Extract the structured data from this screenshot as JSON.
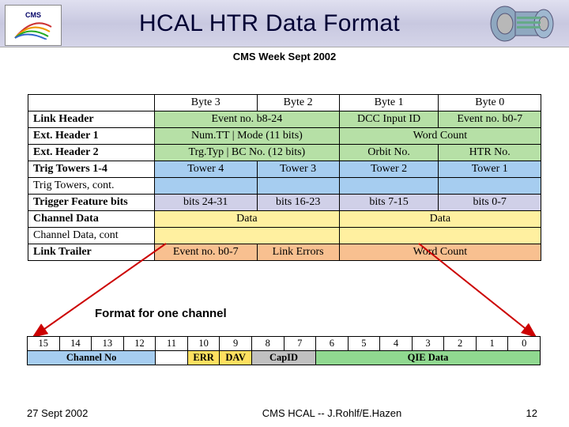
{
  "header": {
    "logo_text": "CMS",
    "title": "HCAL HTR Data Format",
    "subtitle": "CMS Week Sept 2002"
  },
  "main_table": {
    "head": [
      "",
      "Byte 3",
      "Byte 2",
      "Byte 1",
      "Byte 0"
    ],
    "rows": [
      {
        "cls": "r-link",
        "bold": true,
        "label": "Link Header",
        "c": [
          {
            "t": "Event no. b8-24",
            "span": 2
          },
          {
            "t": "DCC Input ID",
            "span": 1
          },
          {
            "t": "Event no. b0-7",
            "span": 1
          }
        ]
      },
      {
        "cls": "r-ext",
        "bold": true,
        "label": "Ext. Header 1",
        "c": [
          {
            "t": "Num.TT   |   Mode (11 bits)",
            "span": 2
          },
          {
            "t": "Word Count",
            "span": 2
          }
        ]
      },
      {
        "cls": "r-ext",
        "bold": true,
        "label": "Ext. Header 2",
        "c": [
          {
            "t": "Trg.Typ |   BC No. (12 bits)",
            "span": 2
          },
          {
            "t": "Orbit No.",
            "span": 1
          },
          {
            "t": "HTR No.",
            "span": 1
          }
        ]
      },
      {
        "cls": "r-tower",
        "bold": true,
        "label": "Trig Towers 1-4",
        "c": [
          {
            "t": "Tower 4",
            "span": 1
          },
          {
            "t": "Tower 3",
            "span": 1
          },
          {
            "t": "Tower 2",
            "span": 1
          },
          {
            "t": "Tower 1",
            "span": 1
          }
        ]
      },
      {
        "cls": "r-tower",
        "bold": false,
        "label": "Trig Towers, cont.",
        "c": [
          {
            "t": "",
            "span": 1
          },
          {
            "t": "",
            "span": 1
          },
          {
            "t": "",
            "span": 1
          },
          {
            "t": "",
            "span": 1
          }
        ]
      },
      {
        "cls": "r-feat",
        "bold": true,
        "label": "Trigger Feature bits",
        "c": [
          {
            "t": "bits 24-31",
            "span": 1
          },
          {
            "t": "bits 16-23",
            "span": 1
          },
          {
            "t": "bits 7-15",
            "span": 1
          },
          {
            "t": "bits 0-7",
            "span": 1
          }
        ]
      },
      {
        "cls": "r-chan",
        "bold": true,
        "label": "Channel Data",
        "c": [
          {
            "t": "Data",
            "span": 2
          },
          {
            "t": "Data",
            "span": 2
          }
        ]
      },
      {
        "cls": "r-chan",
        "bold": false,
        "label": "Channel Data, cont",
        "c": [
          {
            "t": "",
            "span": 2
          },
          {
            "t": "",
            "span": 2
          }
        ]
      },
      {
        "cls": "r-trail",
        "bold": true,
        "label": "Link Trailer",
        "c": [
          {
            "t": "Event no. b0-7",
            "span": 1
          },
          {
            "t": "Link Errors",
            "span": 1
          },
          {
            "t": "Word Count",
            "span": 2
          }
        ]
      }
    ]
  },
  "annotation": "Format for one channel",
  "bits_table": {
    "head": [
      "15",
      "14",
      "13",
      "12",
      "11",
      "10",
      "9",
      "8",
      "7",
      "6",
      "5",
      "4",
      "3",
      "2",
      "1",
      "0"
    ],
    "cells": [
      {
        "t": "Channel No",
        "span": 4,
        "cls": "c-chan"
      },
      {
        "t": "",
        "span": 1,
        "cls": "c-white"
      },
      {
        "t": "ERR",
        "span": 1,
        "cls": "c-err"
      },
      {
        "t": "DAV",
        "span": 1,
        "cls": "c-dav"
      },
      {
        "t": "CapID",
        "span": 2,
        "cls": "c-cap"
      },
      {
        "t": "QIE Data",
        "span": 7,
        "cls": "c-qie"
      }
    ]
  },
  "footer": {
    "left": "27 Sept 2002",
    "center": "CMS HCAL -- J.Rohlf/E.Hazen",
    "right": "12"
  }
}
